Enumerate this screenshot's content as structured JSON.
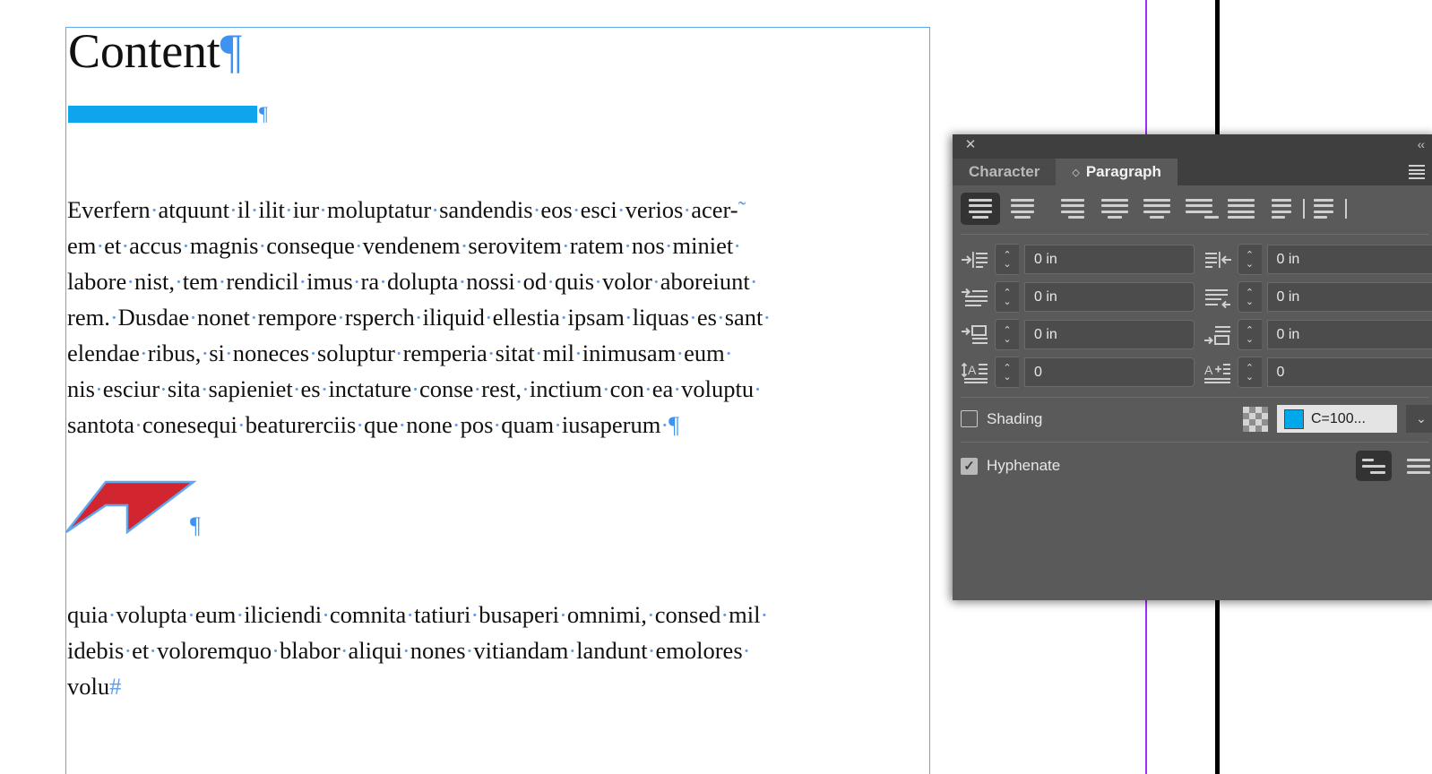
{
  "document": {
    "title": "Content",
    "title_pilcrow": "¶",
    "highlight_bar_pilcrow": "¶",
    "red_shape_pilcrow": "¶",
    "end_of_story_marker": "#",
    "paragraph_1_lines": [
      "Everfern·atquunt·il·ilit·iur·moluptatur·sandendis·eos·esci·verios·acer-",
      "em·et·accus·magnis·conseque·vendenem·serovitem·ratem·nos·miniet·",
      "labore·nist,·tem·rendicil·imus·ra·dolupta·nossi·od·quis·volor·aboreiunt·",
      "rem.·Dusdae·nonet·rempore·rsperch·iliquid·ellestia·ipsam·liquas·es·sant·",
      "elendae·ribus,·si·noneces·soluptur·remperia·sitat·mil·inimusam·eum·",
      "nis·esciur·sita·sapieniet·es·inctature·conse·rest,·inctium·con·ea·voluptu·",
      "santota·conesequi·beaturerciis·que·none·pos·quam·iusaperum·¶"
    ],
    "paragraph_2_lines": [
      "quia·volupta·eum·iliciendi·comnita·tatiuri·busaperi·omnimi,·consed·mil·",
      "idebis·et·voloremquo·blabor·aliqui·nones·vitiandam·landunt·emolores·",
      "volu#"
    ]
  },
  "panel": {
    "close_icon": "✕",
    "collapse_icon": "‹‹",
    "menu_icon": "panel-menu-icon",
    "tabs": [
      {
        "label": "Character",
        "active": false,
        "has_diamond": false
      },
      {
        "label": "Paragraph",
        "active": true,
        "has_diamond": true,
        "diamond": "◇"
      }
    ],
    "alignment_buttons": [
      {
        "name": "align-left",
        "active": true
      },
      {
        "name": "align-center",
        "active": false
      },
      {
        "name": "align-right",
        "active": false
      },
      {
        "name": "justify-last-left",
        "active": false
      },
      {
        "name": "justify-last-center",
        "active": false
      },
      {
        "name": "justify-last-right",
        "active": false
      },
      {
        "name": "justify-all",
        "active": false
      },
      {
        "name": "align-toward-spine",
        "active": false
      },
      {
        "name": "align-away-from-spine",
        "active": false
      }
    ],
    "fields": [
      {
        "name": "left-indent",
        "icon": "left-indent-icon",
        "value": "0 in"
      },
      {
        "name": "right-indent",
        "icon": "right-indent-icon",
        "value": "0 in"
      },
      {
        "name": "first-line-indent",
        "icon": "first-line-indent-icon",
        "value": "0 in"
      },
      {
        "name": "last-line-indent",
        "icon": "last-line-indent-icon",
        "value": "0 in"
      },
      {
        "name": "space-before",
        "icon": "space-before-icon",
        "value": "0 in"
      },
      {
        "name": "space-after",
        "icon": "space-after-icon",
        "value": "0 in"
      },
      {
        "name": "drop-cap-lines",
        "icon": "drop-cap-lines-icon",
        "value": "0"
      },
      {
        "name": "drop-cap-characters",
        "icon": "drop-cap-characters-icon",
        "value": "0"
      }
    ],
    "shading": {
      "label": "Shading",
      "checked": false,
      "swatch_name": "C=100...",
      "swatch_color": "#00a8ea",
      "dropdown_arrow": "⌄"
    },
    "hyphenate": {
      "label": "Hyphenate",
      "checked": true,
      "buttons": [
        {
          "name": "single-line-composer",
          "active": true
        },
        {
          "name": "paragraph-composer",
          "active": false
        }
      ]
    }
  },
  "colors": {
    "panel_bg": "#5a5a5a",
    "panel_titlebar": "#3f3f3f",
    "highlight_cyan": "#0fa5ec",
    "hidden_char_blue": "#5b9bef",
    "frame_blue": "#5fa8f0",
    "shape_red": "#d1252f",
    "guide_purple": "#9b30ff"
  }
}
